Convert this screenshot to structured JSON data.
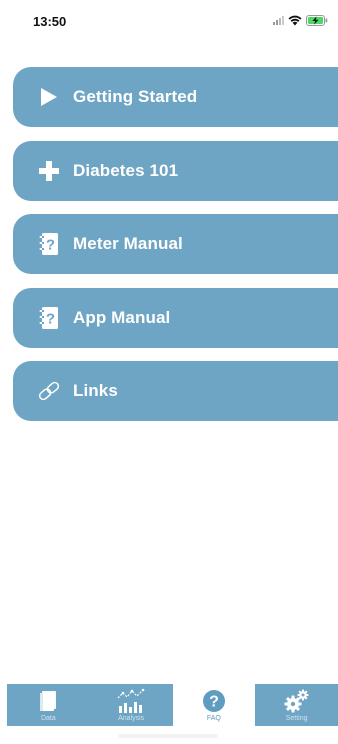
{
  "status_bar": {
    "time": "13:50",
    "icons": [
      "cellular-signal-icon",
      "wifi-icon",
      "battery-charging-icon"
    ]
  },
  "menu": {
    "items": [
      {
        "label": "Getting Started",
        "icon": "play-icon"
      },
      {
        "label": "Diabetes 101",
        "icon": "plus-icon"
      },
      {
        "label": "Meter Manual",
        "icon": "question-notebook-icon"
      },
      {
        "label": "App Manual",
        "icon": "question-notebook-icon"
      },
      {
        "label": "Links",
        "icon": "link-icon"
      }
    ]
  },
  "tabbar": {
    "tabs": [
      {
        "label": "Data",
        "icon": "document-icon",
        "active": false
      },
      {
        "label": "Analysis",
        "icon": "chart-icon",
        "active": false
      },
      {
        "label": "FAQ",
        "icon": "question-circle-icon",
        "active": true
      },
      {
        "label": "Setting",
        "icon": "gears-icon",
        "active": false
      }
    ]
  },
  "colors": {
    "accent": "#6ea5c4",
    "background": "#ffffff",
    "text_on_accent": "#ffffff"
  }
}
